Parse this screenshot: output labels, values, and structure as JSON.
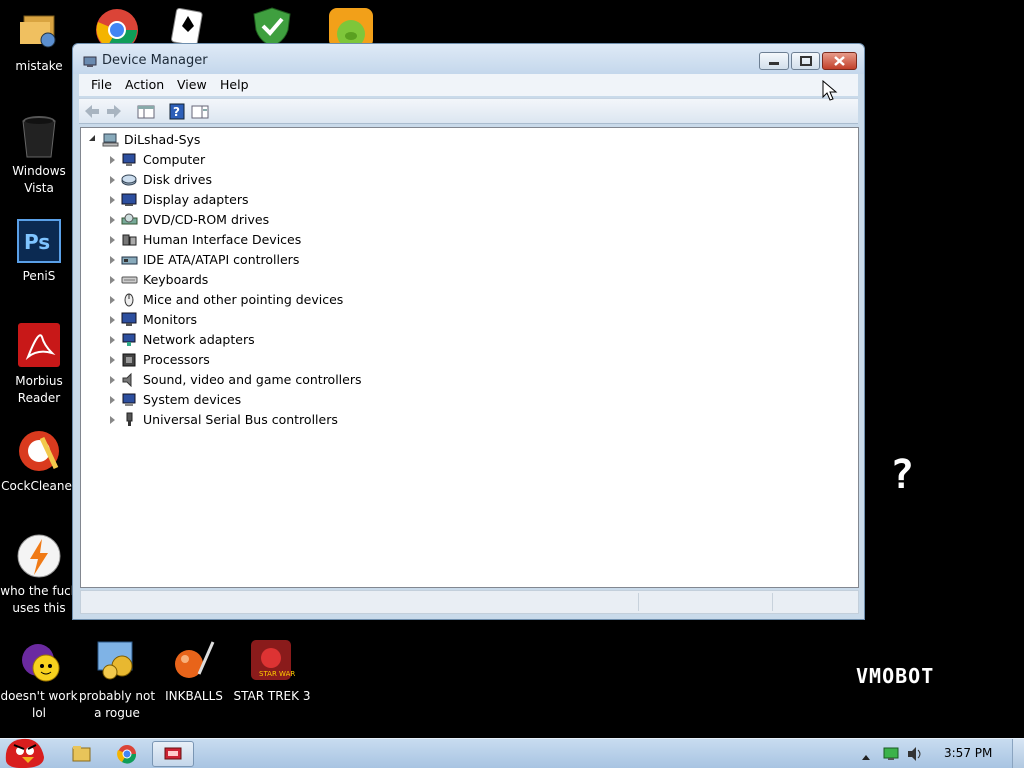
{
  "desktop": {
    "icons": [
      {
        "label": "mistake"
      },
      {
        "label": "Windows Vista"
      },
      {
        "label": "PeniS"
      },
      {
        "label": "Morbius Reader"
      },
      {
        "label": "CockCleaner"
      },
      {
        "label": "who the fuck uses this"
      },
      {
        "label": "doesn't work lol"
      },
      {
        "label": "probably not a rogue"
      },
      {
        "label": "INKBALLS"
      },
      {
        "label": "STAR TREK 3"
      }
    ],
    "top_icons": [
      "chrome-icon",
      "solitaire-icon",
      "security-shield-icon",
      "bad-piggies-icon"
    ],
    "question_mark": "?",
    "watermark": "VMOBOT"
  },
  "window": {
    "title": "Device Manager",
    "menu": {
      "file": "File",
      "action": "Action",
      "view": "View",
      "help": "Help"
    },
    "tree": {
      "root": "DiLshad-Sys",
      "items": [
        {
          "label": "Computer",
          "icon": "computer-icon"
        },
        {
          "label": "Disk drives",
          "icon": "disk-drive-icon"
        },
        {
          "label": "Display adapters",
          "icon": "display-adapter-icon"
        },
        {
          "label": "DVD/CD-ROM drives",
          "icon": "dvd-drive-icon"
        },
        {
          "label": "Human Interface Devices",
          "icon": "hid-icon"
        },
        {
          "label": "IDE ATA/ATAPI controllers",
          "icon": "ide-controller-icon"
        },
        {
          "label": "Keyboards",
          "icon": "keyboard-icon"
        },
        {
          "label": "Mice and other pointing devices",
          "icon": "mouse-icon"
        },
        {
          "label": "Monitors",
          "icon": "monitor-icon"
        },
        {
          "label": "Network adapters",
          "icon": "network-adapter-icon"
        },
        {
          "label": "Processors",
          "icon": "processor-icon"
        },
        {
          "label": "Sound, video and game controllers",
          "icon": "speaker-icon"
        },
        {
          "label": "System devices",
          "icon": "system-device-icon"
        },
        {
          "label": "Universal Serial Bus controllers",
          "icon": "usb-icon"
        }
      ]
    }
  },
  "taskbar": {
    "clock": "3:57 PM"
  },
  "colors": {
    "accent": "#c9daea",
    "close_red": "#c2402a",
    "taskbar": "#b4cde6"
  }
}
